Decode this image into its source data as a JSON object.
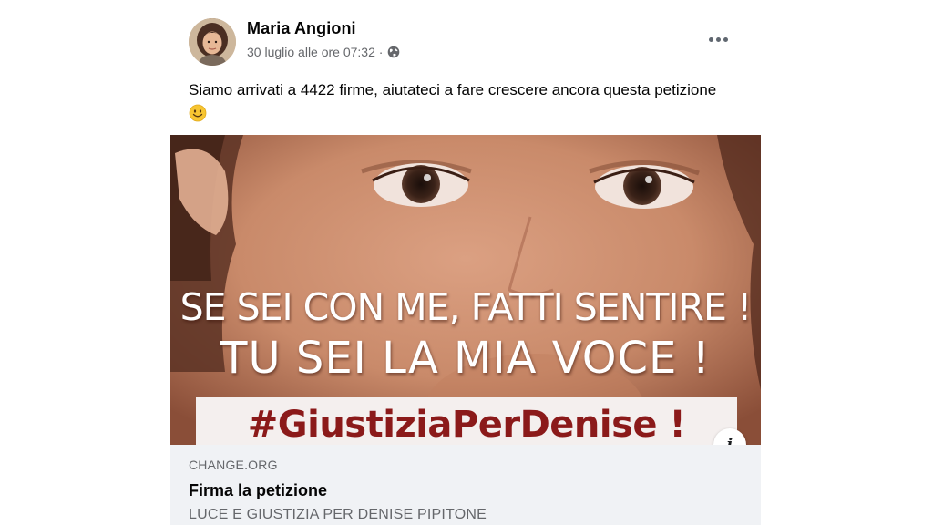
{
  "post": {
    "author": "Maria Angioni",
    "timestamp": "30 luglio alle ore 07:32 ·",
    "privacy_icon": "globe-icon",
    "more_icon": "more-options-icon",
    "text_main": "Siamo arrivati a 4422 firme, aiutateci a fare crescere ancora questa petizione",
    "emoji_icon": "slightly-smiling-face-emoji"
  },
  "image": {
    "line1": "SE SEI CON ME, FATTI SENTIRE !",
    "line2": "TU SEI LA MIA VOCE !",
    "hashtag": "#GiustiziaPerDenise !",
    "hashtag_color": "#8b1a1a"
  },
  "link": {
    "domain": "CHANGE.ORG",
    "title": "Firma la petizione",
    "description": "LUCE E GIUSTIZIA PER DENISE PIPITONE",
    "info_icon": "info-icon",
    "info_label": "i"
  },
  "colors": {
    "text_primary": "#050505",
    "text_secondary": "#65676b",
    "preview_bg": "#f0f2f5"
  }
}
